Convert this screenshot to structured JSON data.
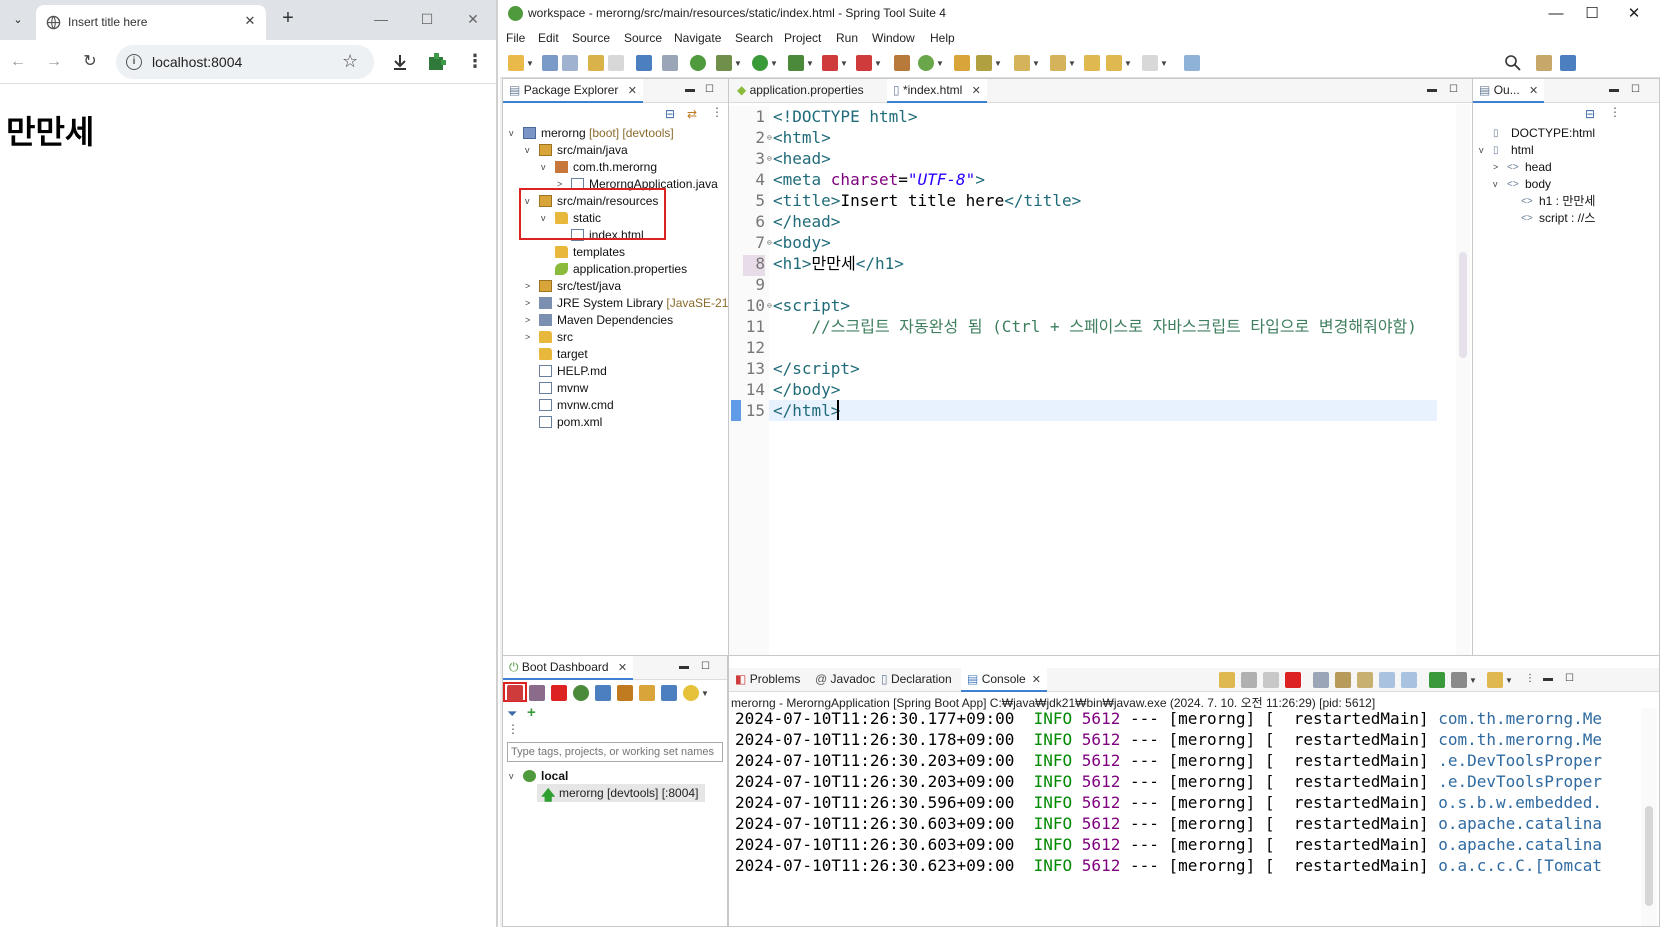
{
  "browser": {
    "tab_title": "Insert title here",
    "url": "localhost:8004",
    "heading": "만만세"
  },
  "ide": {
    "window_title": "workspace - merorng/src/main/resources/static/index.html - Spring Tool Suite 4",
    "menu": [
      "File",
      "Edit",
      "Source",
      "Source",
      "Navigate",
      "Search",
      "Project",
      "Run",
      "Window",
      "Help"
    ],
    "package_explorer": {
      "tab": "Package Explorer",
      "tree": [
        {
          "label": "merorng",
          "deco": " [boot] [devtools]",
          "icon": "proj",
          "indent": 0,
          "twisty": "v"
        },
        {
          "label": "src/main/java",
          "deco": "",
          "icon": "srcfolder",
          "indent": 1,
          "twisty": "v"
        },
        {
          "label": "com.th.merorng",
          "deco": "",
          "icon": "pkgico",
          "indent": 2,
          "twisty": "v"
        },
        {
          "label": "MerorngApplication.java",
          "deco": "",
          "icon": "file",
          "indent": 3,
          "twisty": ">"
        },
        {
          "label": "src/main/resources",
          "deco": "",
          "icon": "srcfolder",
          "indent": 1,
          "twisty": "v"
        },
        {
          "label": "static",
          "deco": "",
          "icon": "folder",
          "indent": 2,
          "twisty": "v"
        },
        {
          "label": "index.html",
          "deco": "",
          "icon": "file",
          "indent": 3,
          "twisty": ""
        },
        {
          "label": "templates",
          "deco": "",
          "icon": "folder",
          "indent": 2,
          "twisty": ""
        },
        {
          "label": "application.properties",
          "deco": "",
          "icon": "prop",
          "indent": 2,
          "twisty": ""
        },
        {
          "label": "src/test/java",
          "deco": "",
          "icon": "srcfolder",
          "indent": 1,
          "twisty": ">"
        },
        {
          "label": "JRE System Library",
          "deco": " [JavaSE-21]",
          "icon": "lib",
          "indent": 1,
          "twisty": ">"
        },
        {
          "label": "Maven Dependencies",
          "deco": "",
          "icon": "lib",
          "indent": 1,
          "twisty": ">"
        },
        {
          "label": "src",
          "deco": "",
          "icon": "folder",
          "indent": 1,
          "twisty": ">"
        },
        {
          "label": "target",
          "deco": "",
          "icon": "folder",
          "indent": 1,
          "twisty": ""
        },
        {
          "label": "HELP.md",
          "deco": "",
          "icon": "file",
          "indent": 1,
          "twisty": ""
        },
        {
          "label": "mvnw",
          "deco": "",
          "icon": "file",
          "indent": 1,
          "twisty": ""
        },
        {
          "label": "mvnw.cmd",
          "deco": "",
          "icon": "file",
          "indent": 1,
          "twisty": ""
        },
        {
          "label": "pom.xml",
          "deco": "",
          "icon": "file",
          "indent": 1,
          "twisty": ""
        }
      ]
    },
    "editor": {
      "tabs": [
        "application.properties",
        "*index.html"
      ],
      "lines": [
        {
          "n": "1",
          "fold": "",
          "html": "<span class=\"tag\">&lt;!DOCTYPE html&gt;</span>"
        },
        {
          "n": "2",
          "fold": "⊖",
          "html": "<span class=\"tag\">&lt;html&gt;</span>"
        },
        {
          "n": "3",
          "fold": "⊖",
          "html": "<span class=\"tag\">&lt;head&gt;</span>"
        },
        {
          "n": "4",
          "fold": "",
          "html": "<span class=\"tag\">&lt;meta </span><span class=\"attr\">charset</span>=<span class=\"str\">\"UTF-8\"</span><span class=\"tag\">&gt;</span>"
        },
        {
          "n": "5",
          "fold": "",
          "html": "<span class=\"tag\">&lt;title&gt;</span>Insert title here<span class=\"tag\">&lt;/title&gt;</span>"
        },
        {
          "n": "6",
          "fold": "",
          "html": "<span class=\"tag\">&lt;/head&gt;</span>"
        },
        {
          "n": "7",
          "fold": "⊖",
          "html": "<span class=\"tag\">&lt;body&gt;</span>"
        },
        {
          "n": "8",
          "fold": "",
          "html": "<span class=\"tag\">&lt;h1&gt;</span>만만세<span class=\"tag\">&lt;/h1&gt;</span>"
        },
        {
          "n": "9",
          "fold": "",
          "html": ""
        },
        {
          "n": "10",
          "fold": "⊖",
          "html": "<span class=\"tag\">&lt;script&gt;</span>"
        },
        {
          "n": "11",
          "fold": "",
          "html": "    <span class=\"cmt\">//스크립트 자동완성 됨 (Ctrl + 스페이스로 자바스크립트 타입으로 변경해줘야함)</span>"
        },
        {
          "n": "12",
          "fold": "",
          "html": ""
        },
        {
          "n": "13",
          "fold": "",
          "html": "<span class=\"tag\">&lt;/script&gt;</span>"
        },
        {
          "n": "14",
          "fold": "",
          "html": "<span class=\"tag\">&lt;/body&gt;</span>"
        },
        {
          "n": "15",
          "fold": "",
          "html": "<span class=\"tag\">&lt;/html&gt;</span>"
        }
      ]
    },
    "outline": {
      "tab": "Ou...",
      "items": [
        {
          "label": "DOCTYPE:html",
          "indent": 0,
          "twisty": ""
        },
        {
          "label": "html",
          "indent": 0,
          "twisty": "v"
        },
        {
          "label": "head",
          "indent": 1,
          "twisty": ">"
        },
        {
          "label": "body",
          "indent": 1,
          "twisty": "v"
        },
        {
          "label": "h1 : 만만세",
          "indent": 2,
          "twisty": ""
        },
        {
          "label": "script : //스",
          "indent": 2,
          "twisty": ""
        }
      ]
    },
    "boot_dashboard": {
      "tab": "Boot Dashboard",
      "filter_placeholder": "Type tags, projects, or working set names",
      "local_label": "local",
      "app_label": "merorng [devtools] [:8004]"
    },
    "console": {
      "tabs": [
        "Problems",
        "Javadoc",
        "Declaration",
        "Console"
      ],
      "header": "merorng - MerorngApplication [Spring Boot App] C:₩java₩jdk21₩bin₩javaw.exe  (2024. 7. 10. 오전 11:26:29) [pid: 5612]",
      "lines": [
        {
          "ts": "2024-07-10T11:26:30.177+09:00",
          "logger": "com.th.merorng.Me"
        },
        {
          "ts": "2024-07-10T11:26:30.178+09:00",
          "logger": "com.th.merorng.Me"
        },
        {
          "ts": "2024-07-10T11:26:30.203+09:00",
          "logger": ".e.DevToolsProper"
        },
        {
          "ts": "2024-07-10T11:26:30.203+09:00",
          "logger": ".e.DevToolsProper"
        },
        {
          "ts": "2024-07-10T11:26:30.596+09:00",
          "logger": "o.s.b.w.embedded."
        },
        {
          "ts": "2024-07-10T11:26:30.603+09:00",
          "logger": "o.apache.catalina"
        },
        {
          "ts": "2024-07-10T11:26:30.603+09:00",
          "logger": "o.apache.catalina"
        },
        {
          "ts": "2024-07-10T11:26:30.623+09:00",
          "logger": "o.a.c.c.C.[Tomcat"
        }
      ],
      "level": "INFO",
      "pid": "5612",
      "sep": "---",
      "app": "[merorng]",
      "thread": "[  restartedMain]"
    }
  }
}
